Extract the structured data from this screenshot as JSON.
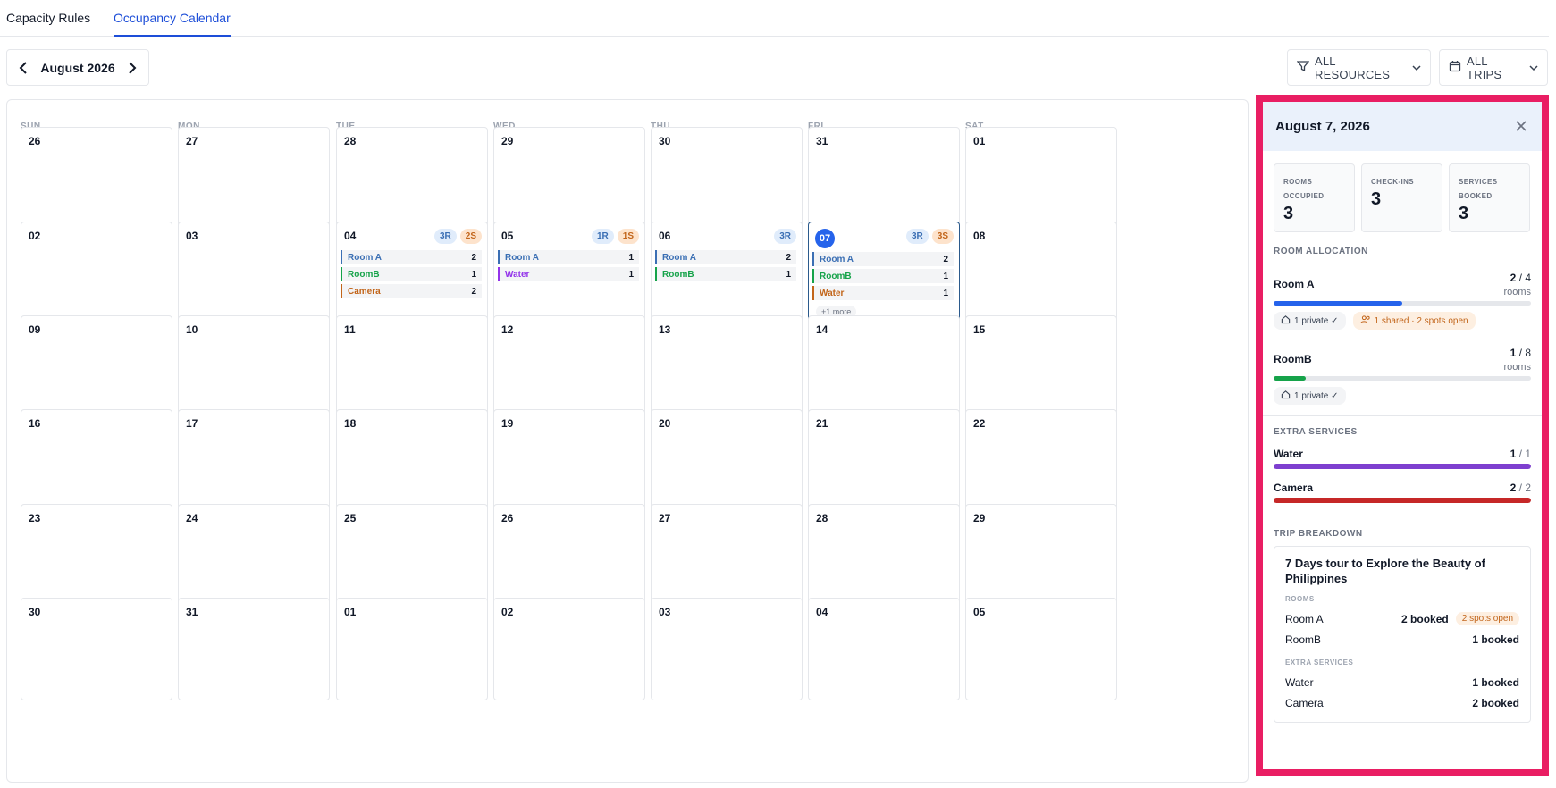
{
  "tabs": [
    {
      "label": "Capacity Rules",
      "active": false
    },
    {
      "label": "Occupancy Calendar",
      "active": true
    }
  ],
  "toolbar": {
    "month_label": "August 2026",
    "filter_resources": "ALL RESOURCES",
    "filter_trips": "ALL TRIPS"
  },
  "calendar": {
    "weekdays": [
      "SUN",
      "MON",
      "TUE",
      "WED",
      "THU",
      "FRI",
      "SAT"
    ],
    "weeks": [
      [
        "26",
        "27",
        "28",
        "29",
        "30",
        "31",
        "01"
      ],
      [
        "02",
        "03",
        "04",
        "05",
        "06",
        "07",
        "08"
      ],
      [
        "09",
        "10",
        "11",
        "12",
        "13",
        "14",
        "15"
      ],
      [
        "16",
        "17",
        "18",
        "19",
        "20",
        "21",
        "22"
      ],
      [
        "23",
        "24",
        "25",
        "26",
        "27",
        "28",
        "29"
      ],
      [
        "30",
        "31",
        "01",
        "02",
        "03",
        "04",
        "05"
      ]
    ],
    "selected_day": "07",
    "day_details": {
      "04": {
        "badges": [
          "3R",
          "2S"
        ],
        "rows": [
          {
            "name": "Room A",
            "count": "2",
            "color": "#3b6fb4"
          },
          {
            "name": "RoomB",
            "count": "1",
            "color": "#16a34a"
          },
          {
            "name": "Camera",
            "count": "2",
            "color": "#c2651a"
          }
        ]
      },
      "05": {
        "badges": [
          "1R",
          "1S"
        ],
        "rows": [
          {
            "name": "Room A",
            "count": "1",
            "color": "#3b6fb4"
          },
          {
            "name": "Water",
            "count": "1",
            "color": "#9333ea"
          }
        ]
      },
      "06": {
        "badges": [
          "3R"
        ],
        "rows": [
          {
            "name": "Room A",
            "count": "2",
            "color": "#3b6fb4"
          },
          {
            "name": "RoomB",
            "count": "1",
            "color": "#16a34a"
          }
        ]
      },
      "07": {
        "badges": [
          "3R",
          "3S"
        ],
        "rows": [
          {
            "name": "Room A",
            "count": "2",
            "color": "#3b6fb4"
          },
          {
            "name": "RoomB",
            "count": "1",
            "color": "#16a34a"
          },
          {
            "name": "Water",
            "count": "1",
            "color": "#c2651a"
          }
        ],
        "more": "+1 more"
      }
    }
  },
  "panel": {
    "date_title": "August 7, 2026",
    "stats": [
      {
        "label": "ROOMS OCCUPIED",
        "value": "3"
      },
      {
        "label": "CHECK-INS",
        "value": "3"
      },
      {
        "label": "SERVICES BOOKED",
        "value": "3"
      }
    ],
    "room_allocation_title": "ROOM ALLOCATION",
    "rooms": [
      {
        "name": "Room A",
        "used": "2",
        "total": "/ 4",
        "unit": "rooms",
        "fill": 0.5,
        "color": "#2563eb",
        "chips": [
          {
            "text": "1 private ✓",
            "type": "home"
          },
          {
            "text": "1 shared · 2 spots open",
            "type": "shared"
          }
        ]
      },
      {
        "name": "RoomB",
        "used": "1",
        "total": "/ 8",
        "unit": "rooms",
        "fill": 0.125,
        "color": "#16a34a",
        "chips": [
          {
            "text": "1 private ✓",
            "type": "home"
          }
        ]
      }
    ],
    "extra_services_title": "EXTRA SERVICES",
    "services": [
      {
        "name": "Water",
        "used": "1",
        "total": "/ 1",
        "fill": 1.0,
        "color": "#7e3fcf"
      },
      {
        "name": "Camera",
        "used": "2",
        "total": "/ 2",
        "fill": 1.0,
        "color": "#c62828"
      }
    ],
    "trip_breakdown_title": "TRIP BREAKDOWN",
    "trip": {
      "name": "7 Days tour to Explore the Beauty of Philippines",
      "rooms_label": "ROOMS",
      "rooms": [
        {
          "name": "Room A",
          "booked": "2 booked",
          "spots": "2 spots open"
        },
        {
          "name": "RoomB",
          "booked": "1 booked",
          "spots": ""
        }
      ],
      "services_label": "EXTRA SERVICES",
      "services": [
        {
          "name": "Water",
          "booked": "1 booked"
        },
        {
          "name": "Camera",
          "booked": "2 booked"
        }
      ]
    }
  }
}
